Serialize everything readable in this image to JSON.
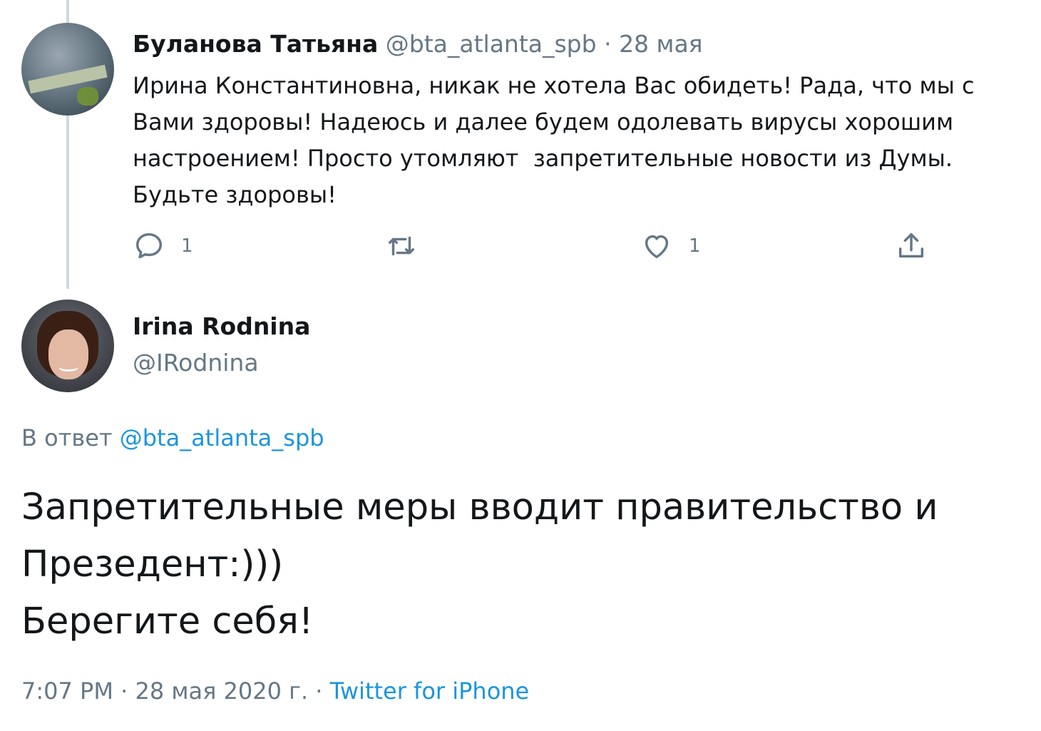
{
  "parent_tweet": {
    "display_name": "Буланова Татьяна",
    "handle": "@bta_atlanta_spb",
    "separator": " · ",
    "date": "28 мая",
    "text": "Ирина Константиновна, никак не хотела Вас обидеть! Рада, что мы с Вами здоровы! Надеюсь и далее будем одолевать вирусы хорошим настроением! Просто утомляют  запретительные новости из Думы. Будьте здоровы!",
    "reply_count": "1",
    "like_count": "1"
  },
  "main_tweet": {
    "display_name": "Irina Rodnina",
    "handle": "@IRodnina",
    "reply_prefix": "В ответ",
    "reply_to": "@bta_atlanta_spb",
    "text_line1": "Запретительные меры вводит правительство и",
    "text_line2": "Презедент:)))",
    "text_line3": "Берегите себя!",
    "time": "7:07 PM",
    "separator": " · ",
    "date": "28 мая 2020 г.",
    "source_separator": " · ",
    "source": "Twitter for iPhone"
  },
  "icons": {
    "reply": "reply-icon",
    "retweet": "retweet-icon",
    "like": "heart-icon",
    "share": "share-icon"
  },
  "colors": {
    "text": "#14171a",
    "muted": "#657786",
    "link": "#1b95e0",
    "thread_line": "#cfd9de"
  }
}
